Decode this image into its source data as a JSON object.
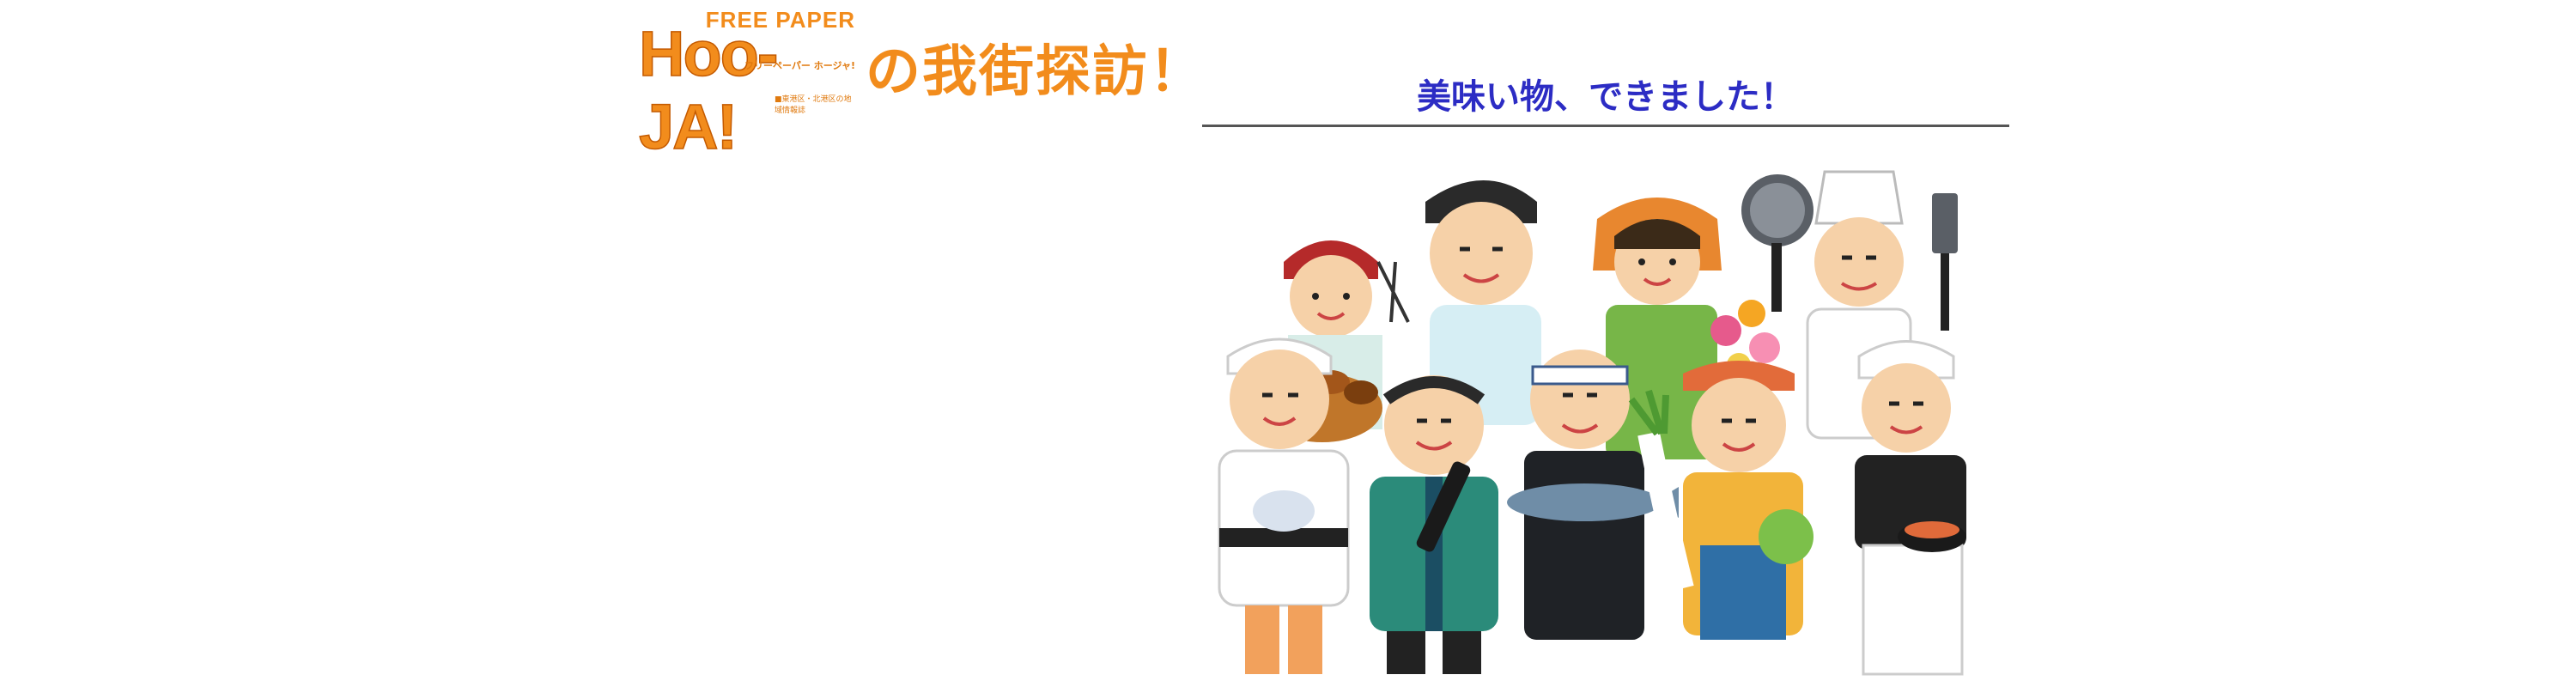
{
  "logo": {
    "top_text": "FREE PAPER",
    "main_text": "Hoo-JA!",
    "sub_text": "フリーペーパー ホージャ!",
    "foot_text": "■東港区・北港区の地域情報誌",
    "accent_color": "#f28c1c"
  },
  "heading": {
    "text": "の我街探訪！",
    "color": "#f28c1c"
  },
  "subheading": {
    "text": "美味い物、できました！",
    "color": "#2c2cc4"
  },
  "illustration": {
    "icon": "food-workers-group-illustration"
  },
  "colors": {
    "rule": "#555555",
    "background": "#ffffff"
  }
}
